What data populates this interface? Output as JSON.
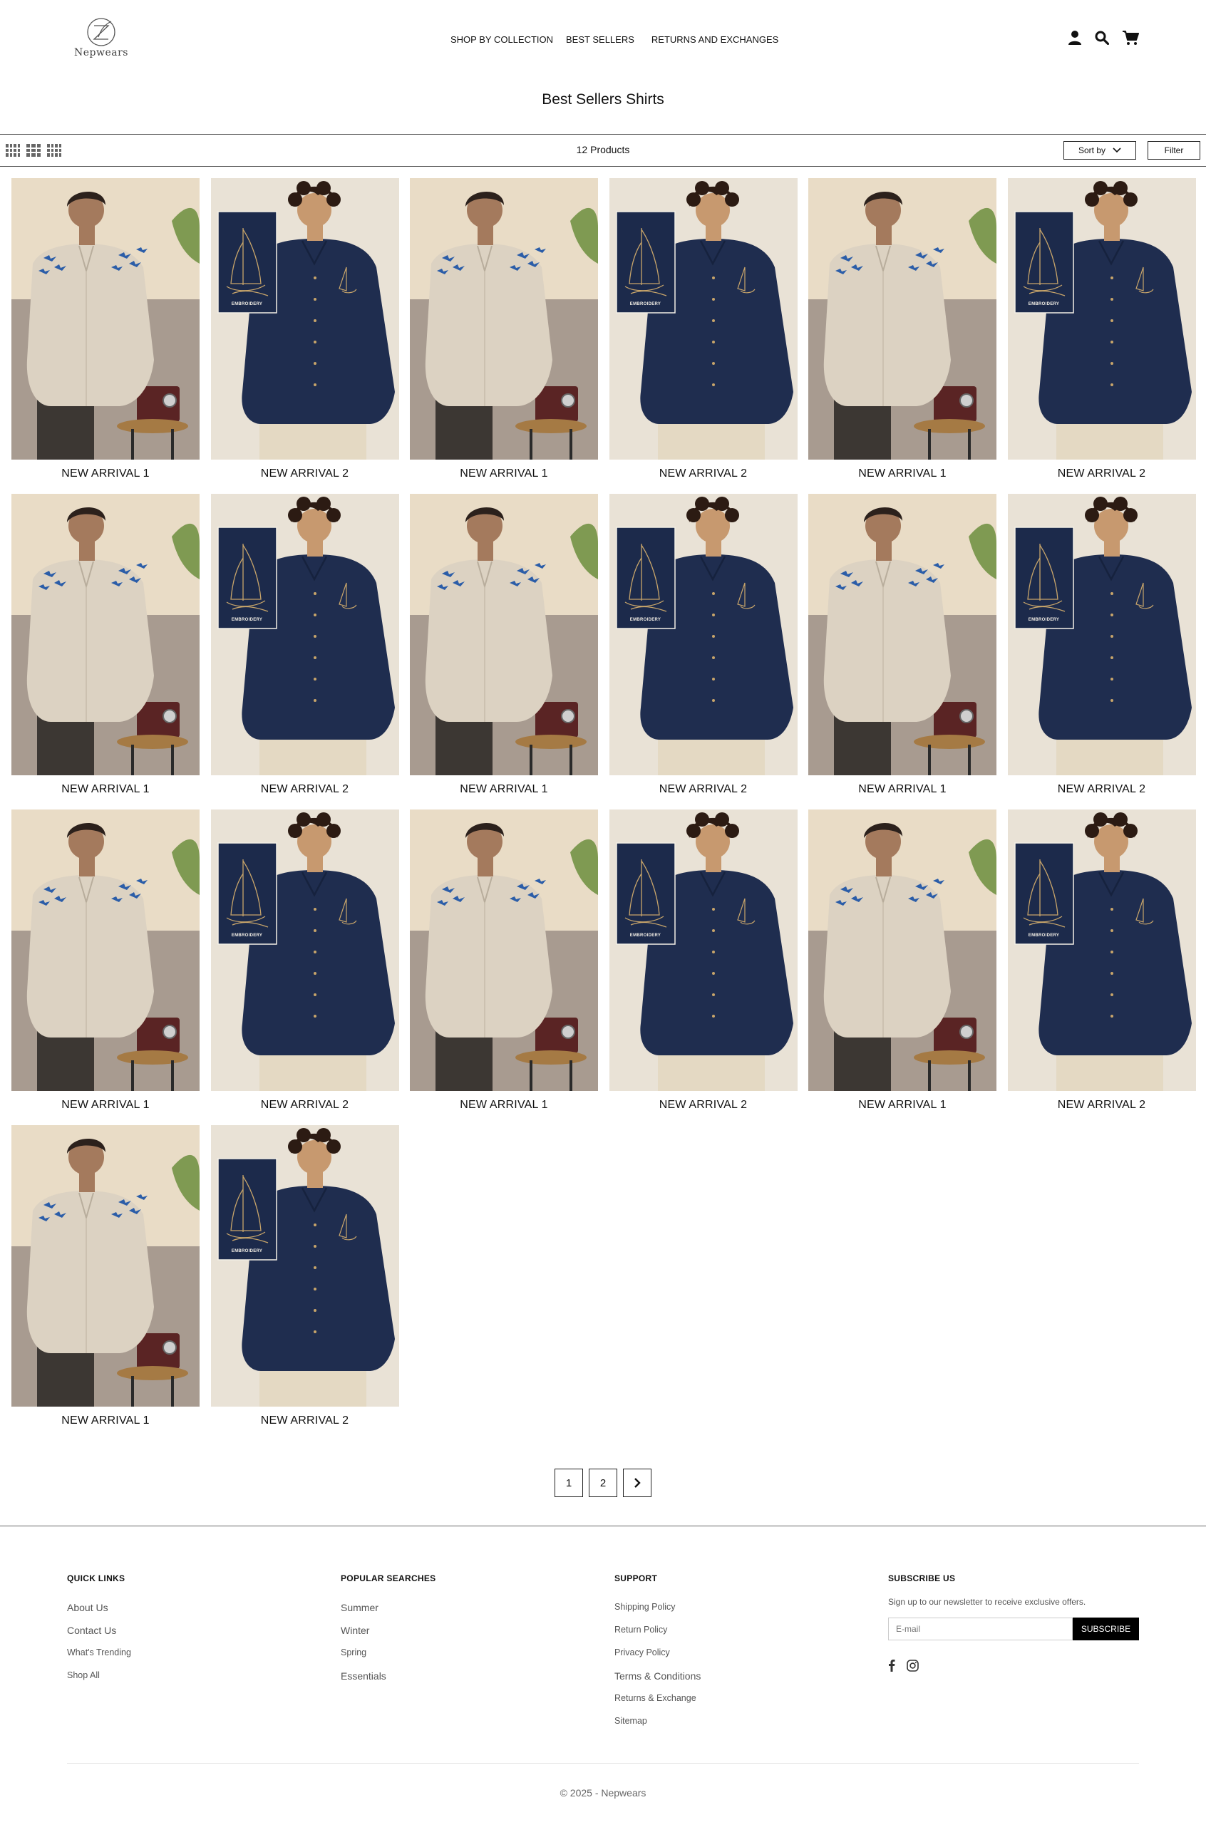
{
  "brand": {
    "logo_text": "Nepwears"
  },
  "nav": {
    "items": [
      "SHOP BY COLLECTION",
      "BEST SELLERS",
      "RETURNS AND EXCHANGES"
    ]
  },
  "header_icons": [
    "user-icon",
    "search-icon",
    "cart-icon"
  ],
  "page": {
    "title": "Best Sellers Shirts"
  },
  "toolbar": {
    "product_count": "12 Products",
    "sort_label": "Sort by",
    "filter_label": "Filter",
    "grid_options": [
      "grid-4-icon",
      "grid-3-icon",
      "grid-3-dense-icon"
    ]
  },
  "products": [
    {
      "name": "NEW ARRIVAL 1",
      "variant": "light"
    },
    {
      "name": "NEW ARRIVAL 2",
      "variant": "navy"
    },
    {
      "name": "NEW ARRIVAL 1",
      "variant": "light"
    },
    {
      "name": "NEW ARRIVAL 2",
      "variant": "navy"
    },
    {
      "name": "NEW ARRIVAL 1",
      "variant": "light"
    },
    {
      "name": "NEW ARRIVAL 2",
      "variant": "navy"
    },
    {
      "name": "NEW ARRIVAL 1",
      "variant": "light"
    },
    {
      "name": "NEW ARRIVAL 2",
      "variant": "navy"
    },
    {
      "name": "NEW ARRIVAL 1",
      "variant": "light"
    },
    {
      "name": "NEW ARRIVAL 2",
      "variant": "navy"
    },
    {
      "name": "NEW ARRIVAL 1",
      "variant": "light"
    },
    {
      "name": "NEW ARRIVAL 2",
      "variant": "navy"
    },
    {
      "name": "NEW ARRIVAL 1",
      "variant": "light"
    },
    {
      "name": "NEW ARRIVAL 2",
      "variant": "navy"
    },
    {
      "name": "NEW ARRIVAL 1",
      "variant": "light"
    },
    {
      "name": "NEW ARRIVAL 2",
      "variant": "navy"
    },
    {
      "name": "NEW ARRIVAL 1",
      "variant": "light"
    },
    {
      "name": "NEW ARRIVAL 2",
      "variant": "navy"
    },
    {
      "name": "NEW ARRIVAL 1",
      "variant": "light"
    },
    {
      "name": "NEW ARRIVAL 2",
      "variant": "navy"
    }
  ],
  "badge": {
    "label": "EMBROIDERY"
  },
  "pagination": {
    "pages": [
      "1",
      "2"
    ],
    "next_icon": "chevron-right-icon"
  },
  "footer": {
    "quick_links": {
      "title": "QUICK LINKS",
      "items": [
        "About Us",
        "Contact Us",
        "What's Trending",
        "Shop All"
      ]
    },
    "popular": {
      "title": "POPULAR SEARCHES",
      "items": [
        "Summer",
        "Winter",
        "Spring",
        "Essentials"
      ]
    },
    "support": {
      "title": "SUPPORT",
      "items": [
        "Shipping Policy",
        "Return Policy",
        "Privacy Policy",
        "Terms & Conditions",
        "Returns & Exchange",
        "Sitemap"
      ]
    },
    "subscribe": {
      "title": "SUBSCRIBE US",
      "text": "Sign up to our newsletter to receive exclusive offers.",
      "placeholder": "E-mail",
      "button": "SUBSCRIBE"
    },
    "social": [
      "facebook-icon",
      "instagram-icon"
    ],
    "copyright": "© 2025 - Nepwears"
  },
  "colors": {
    "navy_shirt": "#1f2d4f",
    "light_shirt": "#d9d0c1",
    "text": "#111111",
    "footer_text": "#555555"
  }
}
